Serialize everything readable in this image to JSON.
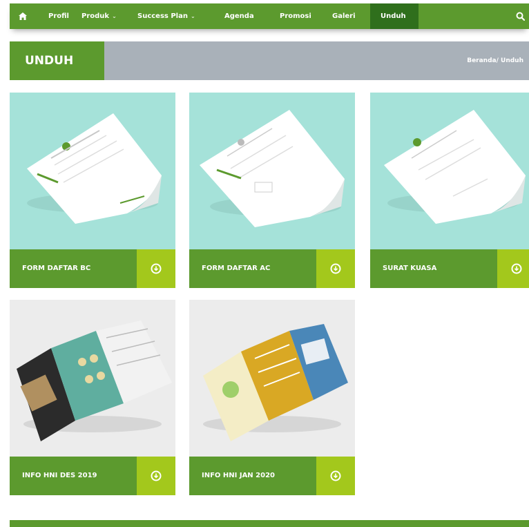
{
  "nav": {
    "home_icon": "home-icon",
    "items": [
      {
        "label": "Profil",
        "caret": false
      },
      {
        "label": "Produk",
        "caret": true
      },
      {
        "label": "Success Plan",
        "caret": true
      },
      {
        "label": "Agenda",
        "caret": false
      },
      {
        "label": "Promosi",
        "caret": false
      },
      {
        "label": "Galeri",
        "caret": false
      },
      {
        "label": "Unduh",
        "caret": false,
        "active": true
      }
    ],
    "search_icon": "search-icon",
    "caret_glyph": "⌄"
  },
  "page": {
    "title": "UNDUH",
    "breadcrumb": "Beranda/ Unduh"
  },
  "downloads": [
    {
      "label": "FORM DAFTAR BC",
      "preview": "document"
    },
    {
      "label": "FORM DAFTAR AC",
      "preview": "document"
    },
    {
      "label": "SURAT KUASA",
      "preview": "document"
    },
    {
      "label": "INFO HNI DES 2019",
      "preview": "brochure"
    },
    {
      "label": "INFO HNI JAN 2020",
      "preview": "brochure"
    }
  ],
  "colors": {
    "primary_green": "#5c9a2e",
    "active_green": "#2f6f1c",
    "lime": "#a3c81c",
    "mint": "#a5e2d9",
    "title_bar_grey": "#a9b1b9"
  }
}
